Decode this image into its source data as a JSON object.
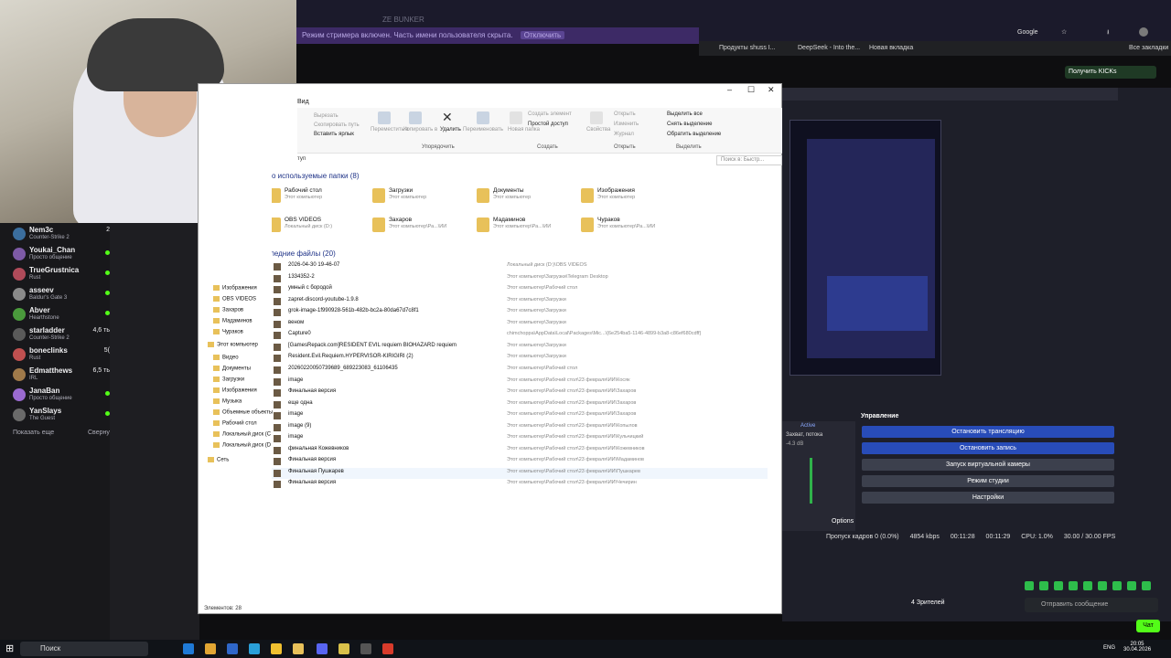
{
  "browser": {
    "bunker_title": "ZE BUNKER",
    "streamer_mode_text": "Режим стримера включен. Часть имени пользователя скрыта.",
    "disable_label": "Отключить",
    "google_label": "Google",
    "bookmarks": [
      "Продукты shuss I...",
      "DeepSeek - Into the...",
      "Новая вкладка"
    ],
    "all_bookmarks": "Все закладки",
    "kick_button": "Получить KICKs"
  },
  "chat": {
    "channels": [
      {
        "name": "Nem3c",
        "game": "Counter-Strike 2",
        "count": "2",
        "avatar": "#3b6e9e"
      },
      {
        "name": "Youkai_Chan",
        "game": "Просто общение",
        "count": "",
        "avatar": "#7d5aa6"
      },
      {
        "name": "TrueGrustnica",
        "game": "Rust",
        "count": "",
        "avatar": "#b04b5a"
      },
      {
        "name": "asseev",
        "game": "Baldur's Gate 3",
        "count": "",
        "avatar": "#8a8a8a"
      },
      {
        "name": "Abver",
        "game": "Hearthstone",
        "count": "",
        "avatar": "#4a9a3c"
      },
      {
        "name": "starladder",
        "game": "Counter-Strike 2",
        "count": "4,6 ть",
        "avatar": "#5a5a5a"
      },
      {
        "name": "boneclinks",
        "game": "Rust",
        "count": "5(",
        "avatar": "#c05050"
      },
      {
        "name": "Edmatthews",
        "game": "IRL",
        "count": "6,5 ть",
        "avatar": "#a07a4a"
      },
      {
        "name": "JanaBan",
        "game": "Просто общение",
        "count": "",
        "avatar": "#9a6ad0"
      },
      {
        "name": "YanSlays",
        "game": "The Guest",
        "count": "",
        "avatar": "#6a6a6a"
      }
    ],
    "show_more": "Показать еще",
    "collapse": "Сверну"
  },
  "explorer": {
    "menu_view": "Вид",
    "ribbon": {
      "cut": "Вырезать",
      "copy_path": "Скопировать путь",
      "paste_shortcut": "Вставить ярлык",
      "move_to": "Переместить в",
      "copy_to": "Копировать в",
      "delete": "Удалить",
      "rename": "Переименовать",
      "new_folder": "Новая папка",
      "new_item": "Создать элемент",
      "easy_access": "Простой доступ",
      "properties": "Свойства",
      "open": "Открыть",
      "edit": "Изменить",
      "history": "Журнал",
      "select_all": "Выделить все",
      "select_none": "Снять выделение",
      "invert_selection": "Обратить выделение",
      "group_organize": "Упорядочить",
      "group_new": "Создать",
      "group_open": "Открыть",
      "group_select": "Выделить"
    },
    "address_suffix": "туп",
    "search_placeholder": "Поиск в: Быстр...",
    "frequent_header": "о используемые папки (8)",
    "frequent_folders": [
      {
        "name": "Рабочий стол",
        "sub": "Этот компьютер"
      },
      {
        "name": "Загрузки",
        "sub": "Этот компьютер"
      },
      {
        "name": "Документы",
        "sub": "Этот компьютер"
      },
      {
        "name": "Изображения",
        "sub": "Этот компьютер"
      },
      {
        "name": "OBS VIDEOS",
        "sub": "Локальный диск (D:)"
      },
      {
        "name": "Захаров",
        "sub": "Этот компьютер\\Ра...\\ИИ"
      },
      {
        "name": "Мадаминов",
        "sub": "Этот компьютер\\Ра...\\ИИ"
      },
      {
        "name": "Чураков",
        "sub": "Этот компьютер\\Ра...\\ИИ"
      }
    ],
    "recent_header": "Последние файлы (20)",
    "recent_files": [
      {
        "name": "2026-04-30 19-46-07",
        "path": "Локальный диск (D:)\\OBS VIDEOS"
      },
      {
        "name": "1334352-2",
        "path": "Этот компьютер\\Загрузки\\Telegram Desktop"
      },
      {
        "name": "умный с бородой",
        "path": "Этот компьютер\\Рабочий стол"
      },
      {
        "name": "zapret-discord-youtube-1.9.8",
        "path": "Этот компьютер\\Загрузки"
      },
      {
        "name": "grok-image-1f990928-561b-482b-bc2a-80da67d7c8f1",
        "path": "Этот компьютер\\Загрузки"
      },
      {
        "name": "веном",
        "path": "Этот компьютер\\Загрузки"
      },
      {
        "name": "Capture0",
        "path": "chimchoppa\\AppData\\Local\\Packages\\Mic...\\{6e254ba5-1146-4899-b3a8-c86ef680cdff}"
      },
      {
        "name": "[GamesRepack.com]RESIDENT EVIL requiem BIOHAZARD requiem",
        "path": "Этот компьютер\\Загрузки"
      },
      {
        "name": "Resident.Evil.Requiem.HYPERVISOR-KIRIGIRI (2)",
        "path": "Этот компьютер\\Загрузки"
      },
      {
        "name": "20260220050739689_689223083_61106435",
        "path": "Этот компьютер\\Рабочий стол"
      },
      {
        "name": "image",
        "path": "Этот компьютер\\Рабочий стол\\23 февраля\\ИИ\\Косяк"
      },
      {
        "name": "Финальная версия",
        "path": "Этот компьютер\\Рабочий стол\\23 февраля\\ИИ\\Захаров"
      },
      {
        "name": "еще одна",
        "path": "Этот компьютер\\Рабочий стол\\23 февраля\\ИИ\\Захаров"
      },
      {
        "name": "image",
        "path": "Этот компьютер\\Рабочий стол\\23 февраля\\ИИ\\Захаров"
      },
      {
        "name": "image (9)",
        "path": "Этот компьютер\\Рабочий стол\\23 февраля\\ИИ\\Копылов"
      },
      {
        "name": "image",
        "path": "Этот компьютер\\Рабочий стол\\23 февраля\\ИИ\\Кульчицкий"
      },
      {
        "name": "финальная Кожевников",
        "path": "Этот компьютер\\Рабочий стол\\23 февраля\\ИИ\\Кожевников"
      },
      {
        "name": "Финальная версия",
        "path": "Этот компьютер\\Рабочий стол\\23 февраля\\ИИ\\Мадаминов"
      },
      {
        "name": "Финальная Пушкарев",
        "path": "Этот компьютер\\Рабочий стол\\23 февраля\\ИИ\\Пушкарев"
      },
      {
        "name": "Финальная версия",
        "path": "Этот компьютер\\Рабочий стол\\23 февраля\\ИИ\\Чечирин"
      }
    ],
    "nav": [
      "Изображения",
      "OBS VIDEOS",
      "Захаров",
      "Мадаминов",
      "Чураков",
      "Этот компьютер",
      "Видео",
      "Документы",
      "Загрузки",
      "Изображения",
      "Музыка",
      "Объемные объекты",
      "Рабочий стол",
      "Локальный диск (C",
      "Локальный диск (D",
      "Сеть"
    ],
    "status": "Элементов: 28"
  },
  "obs": {
    "controls_title": "Управление",
    "start_stream": "Остановить трансляцию",
    "stop_record": "Остановить запись",
    "virtual_cam": "Запуск виртуальной камеры",
    "studio_mode": "Режим студии",
    "settings": "Настройки",
    "options": "Options",
    "active": "Active",
    "capture": "Захват, потока",
    "db": "-4.3 dB",
    "status": {
      "dropped": "Пропуск кадров 0 (0.0%)",
      "bitrate": "4854 kbps",
      "stream_time": "00:11:28",
      "record_time": "00:11:29",
      "cpu": "CPU: 1.0%",
      "fps": "30.00 / 30.00 FPS"
    }
  },
  "kick": {
    "viewers": "4 Зрителей",
    "message_placeholder": "Отправить сообщение",
    "chat_button": "Чат"
  },
  "taskbar": {
    "search": "Поиск",
    "lang": "ENG",
    "time": "20:05",
    "date": "30.04.2026"
  }
}
